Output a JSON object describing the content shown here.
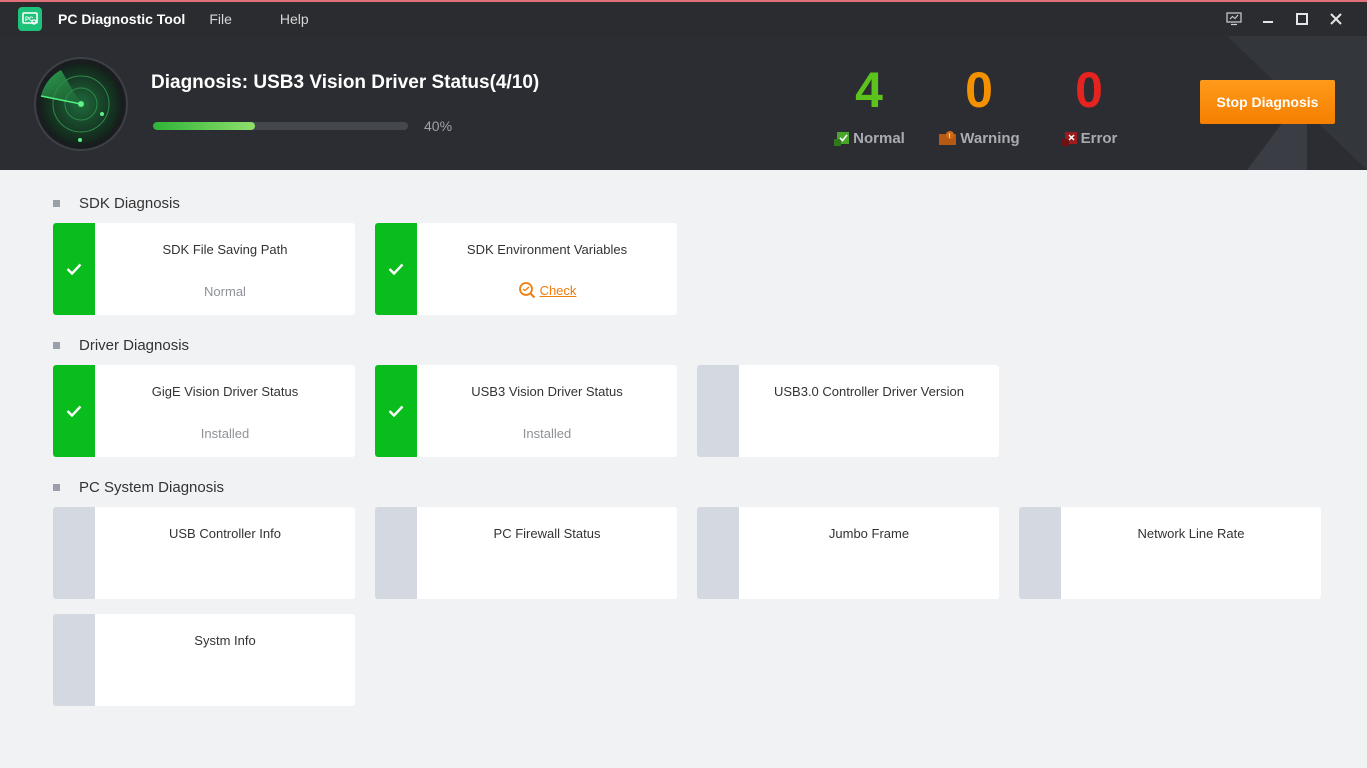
{
  "app": {
    "title": "PC Diagnostic Tool",
    "menu": [
      "File",
      "Help"
    ]
  },
  "header": {
    "diagnosis_title": "Diagnosis: USB3 Vision Driver Status(4/10)",
    "progress": 0.4,
    "progress_label": "40%",
    "stats": {
      "normal": {
        "value": "4",
        "label": "Normal",
        "color": "#5cc21c"
      },
      "warning": {
        "value": "0",
        "label": "Warning",
        "color": "#f39100"
      },
      "error": {
        "value": "0",
        "label": "Error",
        "color": "#e5231f"
      }
    },
    "stop_button": "Stop Diagnosis"
  },
  "sections": {
    "sdk": {
      "title": "SDK Diagnosis",
      "cards": [
        {
          "name": "SDK File Saving Path",
          "status": "Normal",
          "state": "ok"
        },
        {
          "name": "SDK Environment Variables",
          "link": "Check",
          "state": "ok"
        }
      ]
    },
    "driver": {
      "title": "Driver Diagnosis",
      "cards": [
        {
          "name": "GigE Vision Driver Status",
          "status": "Installed",
          "state": "ok"
        },
        {
          "name": "USB3 Vision Driver Status",
          "status": "Installed",
          "state": "ok"
        },
        {
          "name": "USB3.0 Controller Driver Version",
          "status": "",
          "state": "pending"
        }
      ]
    },
    "system": {
      "title": "PC System Diagnosis",
      "cards": [
        {
          "name": "USB Controller Info",
          "state": "pending"
        },
        {
          "name": "PC Firewall Status",
          "state": "pending"
        },
        {
          "name": "Jumbo Frame",
          "state": "pending"
        },
        {
          "name": "Network Line Rate",
          "state": "pending"
        },
        {
          "name": "Systm Info",
          "state": "pending"
        }
      ]
    }
  },
  "icons": {
    "ok": "check-icon",
    "link": "magnifier-refresh-icon"
  },
  "colors": {
    "ok": "#08bd1c",
    "pending": "#d3d8e1",
    "accent": "#f57f00"
  }
}
